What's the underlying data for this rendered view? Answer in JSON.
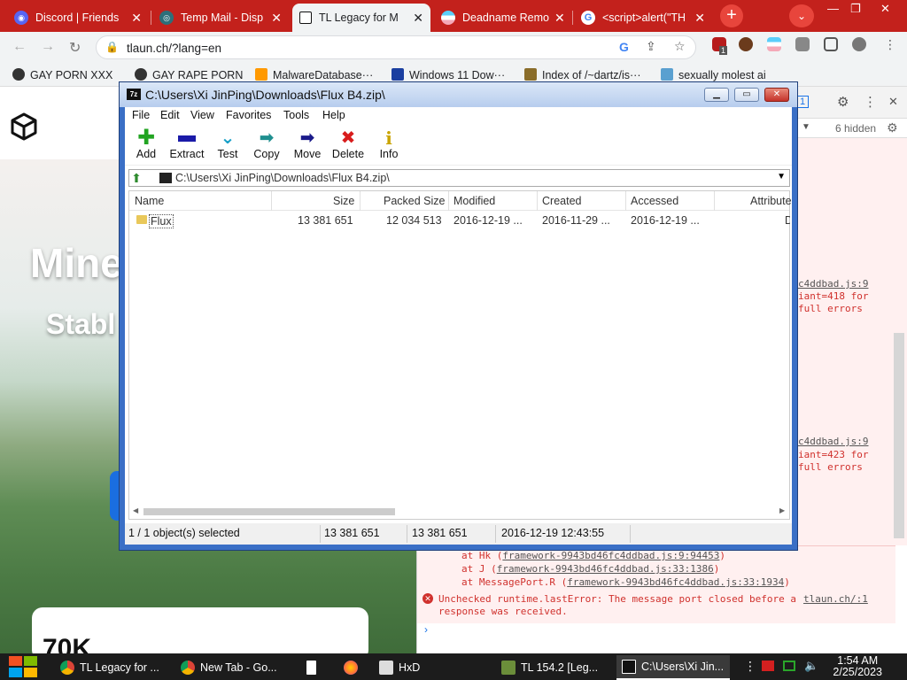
{
  "browser": {
    "tabs": [
      {
        "label": "Discord | Friends",
        "active": false
      },
      {
        "label": "Temp Mail - Disp",
        "active": false
      },
      {
        "label": "TL Legacy for M",
        "active": true
      },
      {
        "label": "Deadname Remo",
        "active": false
      },
      {
        "label": "<script>alert(\"TH",
        "active": false
      }
    ],
    "url": "tlaun.ch/?lang=en",
    "extension_badge": "1",
    "bookmarks": [
      "GAY PORN XXX",
      "GAY RAPE PORN",
      "MalwareDatabase···",
      "Windows 11 Dow···",
      "Index of /~dartz/is···",
      "sexually molest ai"
    ]
  },
  "website": {
    "hero_title": "Mine",
    "hero_subtitle": "Stabl",
    "card_text": "70K"
  },
  "devtools": {
    "issues_count": "1",
    "hidden_label": "6 hidden",
    "error_block_1": [
      "c4ddbad.js:9",
      "iant=418 for",
      "full errors"
    ],
    "error_block_2": [
      "c4ddbad.js:9",
      "iant=423 for",
      "full errors"
    ],
    "stack_lines": [
      {
        "prefix": "at Hk (",
        "link": "framework-9943bd46fc4ddbad.js:9:94453",
        "suffix": ")"
      },
      {
        "prefix": "at J (",
        "link": "framework-9943bd46fc4ddbad.js:33:1386",
        "suffix": ")"
      },
      {
        "prefix": "at MessagePort.R (",
        "link": "framework-9943bd46fc4ddbad.js:33:1934",
        "suffix": ")"
      }
    ],
    "runtime_error": "Unchecked runtime.lastError: The message port closed before a",
    "runtime_error_2": "response was received.",
    "runtime_error_link": "tlaun.ch/:1"
  },
  "sevenzip": {
    "title": "C:\\Users\\Xi JinPing\\Downloads\\Flux B4.zip\\",
    "menu": [
      "File",
      "Edit",
      "View",
      "Favorites",
      "Tools",
      "Help"
    ],
    "tools": [
      {
        "label": "Add",
        "icon": "plus-icon",
        "color": "#22a422"
      },
      {
        "label": "Extract",
        "icon": "minus-icon",
        "color": "#1a1aa8"
      },
      {
        "label": "Test",
        "icon": "check-icon",
        "color": "#18a0c8"
      },
      {
        "label": "Copy",
        "icon": "copy-arrow-icon",
        "color": "#1f8f8f"
      },
      {
        "label": "Move",
        "icon": "move-arrow-icon",
        "color": "#1a1a8a"
      },
      {
        "label": "Delete",
        "icon": "delete-x-icon",
        "color": "#d81c1c"
      },
      {
        "label": "Info",
        "icon": "info-icon",
        "color": "#c9a400"
      }
    ],
    "path": "C:\\Users\\Xi JinPing\\Downloads\\Flux B4.zip\\",
    "columns": [
      "Name",
      "Size",
      "Packed Size",
      "Modified",
      "Created",
      "Accessed",
      "Attribute"
    ],
    "rows": [
      {
        "name": "Flux",
        "size": "13 381 651",
        "packed": "12 034 513",
        "modified": "2016-12-19 ...",
        "created": "2016-11-29 ...",
        "accessed": "2016-12-19 ...",
        "attr": "D"
      }
    ],
    "status": {
      "selection": "1 / 1 object(s) selected",
      "size": "13 381 651",
      "packed": "13 381 651",
      "date": "2016-12-19 12:43:55"
    }
  },
  "taskbar": {
    "items": [
      {
        "label": "TL Legacy for ...",
        "color": "#4285f4"
      },
      {
        "label": "New Tab - Go...",
        "color": "#4285f4"
      },
      {
        "label": "",
        "color": "#ffffff"
      },
      {
        "label": "",
        "color": "#ff7139"
      },
      {
        "label": "HxD",
        "color": "#cccccc"
      },
      {
        "label": "TL 154.2  [Leg...",
        "color": "#7a5a2a"
      },
      {
        "label": "C:\\Users\\Xi Jin...",
        "color": "#222222"
      }
    ],
    "time": "1:54 AM",
    "date": "2/25/2023"
  }
}
